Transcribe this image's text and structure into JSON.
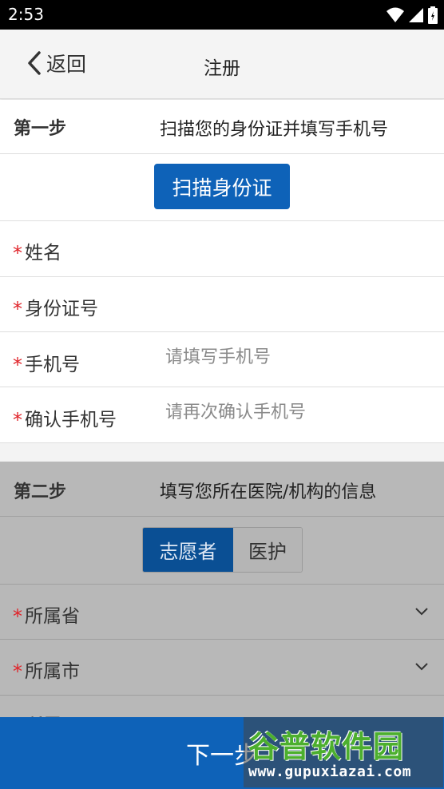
{
  "status_bar": {
    "time": "2:53"
  },
  "nav": {
    "back_label": "返回",
    "title": "注册"
  },
  "step1": {
    "label": "第一步",
    "desc": "扫描您的身份证并填写手机号",
    "scan_button": "扫描身份证",
    "fields": [
      {
        "label": "姓名",
        "required": "*",
        "value": "",
        "placeholder": ""
      },
      {
        "label": "身份证号",
        "required": "*",
        "value": "",
        "placeholder": ""
      },
      {
        "label": "手机号",
        "required": "*",
        "value": "",
        "placeholder": "请填写手机号"
      },
      {
        "label": "确认手机号",
        "required": "*",
        "value": "",
        "placeholder": "请再次确认手机号"
      }
    ]
  },
  "step2": {
    "label": "第二步",
    "desc": "填写您所在医院/机构的信息",
    "segments": [
      {
        "label": "志愿者",
        "selected": true
      },
      {
        "label": "医护",
        "selected": false
      }
    ],
    "fields": [
      {
        "label": "所属省",
        "required": "*"
      },
      {
        "label": "所属市",
        "required": "*"
      },
      {
        "label": "所属区",
        "required": "*"
      }
    ]
  },
  "next_button": "下一步",
  "watermark": {
    "title": "谷普软件园",
    "url": "www.gupuxiazai.com"
  },
  "colors": {
    "primary": "#0e62b8",
    "required": "#e0242a"
  }
}
